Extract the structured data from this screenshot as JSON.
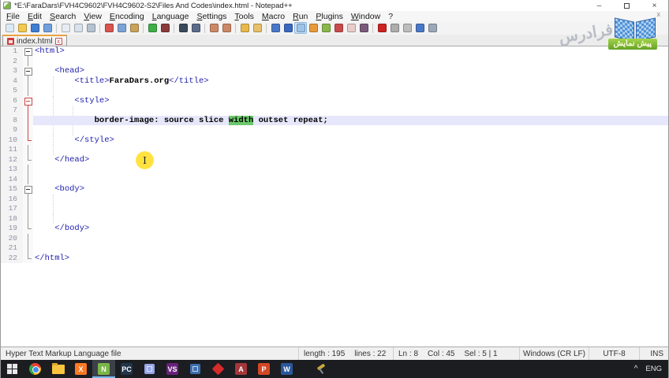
{
  "window": {
    "title": "*E:\\FaraDars\\FVH4C9602\\FVH4C9602-S2\\Files And Codes\\index.html - Notepad++",
    "controls": {
      "minimize": "–",
      "close": "×"
    }
  },
  "menubar": {
    "items": [
      "File",
      "Edit",
      "Search",
      "View",
      "Encoding",
      "Language",
      "Settings",
      "Tools",
      "Macro",
      "Run",
      "Plugins",
      "Window",
      "?"
    ]
  },
  "toolbar": {
    "icons": [
      {
        "name": "new-file-icon",
        "color": "#dce9f4"
      },
      {
        "name": "open-file-icon",
        "color": "#f2c94c"
      },
      {
        "name": "save-icon",
        "color": "#3f7fd2"
      },
      {
        "name": "save-all-icon",
        "color": "#6fa1dd"
      },
      {
        "name": "sep"
      },
      {
        "name": "close-icon",
        "color": "#e6ecf2"
      },
      {
        "name": "close-all-icon",
        "color": "#d9e2ec"
      },
      {
        "name": "print-icon",
        "color": "#b4c3d0"
      },
      {
        "name": "sep"
      },
      {
        "name": "cut-icon",
        "color": "#d9534f"
      },
      {
        "name": "copy-icon",
        "color": "#7aa3d8"
      },
      {
        "name": "paste-icon",
        "color": "#c9a35a"
      },
      {
        "name": "sep"
      },
      {
        "name": "undo-icon",
        "color": "#3fae49"
      },
      {
        "name": "redo-icon",
        "color": "#8b3a3a"
      },
      {
        "name": "sep"
      },
      {
        "name": "find-icon",
        "color": "#3a4a5a"
      },
      {
        "name": "replace-icon",
        "color": "#5a6a8a"
      },
      {
        "name": "sep"
      },
      {
        "name": "zoom-in-icon",
        "color": "#cc8866"
      },
      {
        "name": "zoom-out-icon",
        "color": "#cc8866"
      },
      {
        "name": "sep"
      },
      {
        "name": "sync-scroll-v-icon",
        "color": "#e8b84a"
      },
      {
        "name": "sync-scroll-h-icon",
        "color": "#e8c06a"
      },
      {
        "name": "sep"
      },
      {
        "name": "word-wrap-icon",
        "color": "#4a78c8"
      },
      {
        "name": "show-all-chars-icon",
        "color": "#3a68c0"
      },
      {
        "name": "indent-guide-icon",
        "color": "#9cc2e8",
        "active": true
      },
      {
        "name": "doc-map-icon",
        "color": "#e89a3a"
      },
      {
        "name": "function-list-icon",
        "color": "#8ab84a"
      },
      {
        "name": "edit-marker-icon",
        "color": "#c84a4a"
      },
      {
        "name": "disabled-icon",
        "color": "#e8cccc"
      },
      {
        "name": "monitoring-eye-icon",
        "color": "#7a5a7a"
      },
      {
        "name": "sep"
      },
      {
        "name": "record-macro-icon",
        "color": "#cc2222"
      },
      {
        "name": "stop-macro-icon",
        "color": "#adadad"
      },
      {
        "name": "play-macro-icon",
        "color": "#bdbdbd"
      },
      {
        "name": "run-macro-multi-icon",
        "color": "#4a78c8"
      },
      {
        "name": "save-macro-icon",
        "color": "#9aa8b8"
      }
    ]
  },
  "tabbar": {
    "tab_label": "index.html",
    "close_glyph": "x"
  },
  "editor": {
    "lines": [
      {
        "n": "1",
        "fold": "box",
        "segs": [
          [
            "<html>",
            "tag"
          ]
        ],
        "g": []
      },
      {
        "n": "2",
        "fold": "line",
        "segs": [],
        "g": []
      },
      {
        "n": "3",
        "fold": "box",
        "segs": [
          [
            "    ",
            "p"
          ],
          [
            "<head>",
            "tag"
          ]
        ],
        "g": []
      },
      {
        "n": "4",
        "fold": "line",
        "segs": [
          [
            "        ",
            "p"
          ],
          [
            "<title>",
            "tag"
          ],
          [
            "FaraDars.org",
            "b"
          ],
          [
            "</title>",
            "tag"
          ]
        ],
        "g": [
          4
        ]
      },
      {
        "n": "5",
        "fold": "line",
        "segs": [],
        "g": [
          4
        ]
      },
      {
        "n": "6",
        "fold": "box red",
        "segs": [
          [
            "        ",
            "p"
          ],
          [
            "<style>",
            "tag"
          ]
        ],
        "g": [
          4
        ]
      },
      {
        "n": "7",
        "fold": "line red",
        "segs": [],
        "g": [
          4,
          8
        ]
      },
      {
        "n": "8",
        "fold": "line red",
        "cur": true,
        "segs": [
          [
            "            ",
            "p"
          ],
          [
            "border-image: source slice ",
            "b"
          ],
          [
            "width",
            "sel"
          ],
          [
            " outset repeat;",
            "b"
          ]
        ],
        "g": []
      },
      {
        "n": "9",
        "fold": "line red",
        "segs": [],
        "g": [
          4,
          8
        ]
      },
      {
        "n": "10",
        "fold": "corner red",
        "segs": [
          [
            "        ",
            "p"
          ],
          [
            "</style>",
            "tag"
          ]
        ],
        "g": [
          4
        ]
      },
      {
        "n": "11",
        "fold": "line",
        "segs": [],
        "g": [
          4
        ]
      },
      {
        "n": "12",
        "fold": "corner",
        "segs": [
          [
            "    ",
            "p"
          ],
          [
            "</head>",
            "tag"
          ]
        ],
        "g": []
      },
      {
        "n": "13",
        "fold": "line",
        "segs": [],
        "g": []
      },
      {
        "n": "14",
        "fold": "line",
        "segs": [],
        "g": []
      },
      {
        "n": "15",
        "fold": "box",
        "segs": [
          [
            "    ",
            "p"
          ],
          [
            "<body>",
            "tag"
          ]
        ],
        "g": []
      },
      {
        "n": "16",
        "fold": "line",
        "segs": [],
        "g": [
          4
        ]
      },
      {
        "n": "17",
        "fold": "line",
        "segs": [],
        "g": [
          4
        ]
      },
      {
        "n": "18",
        "fold": "line",
        "segs": [],
        "g": [
          4
        ]
      },
      {
        "n": "19",
        "fold": "corner",
        "segs": [
          [
            "    ",
            "p"
          ],
          [
            "</body>",
            "tag"
          ]
        ],
        "g": []
      },
      {
        "n": "20",
        "fold": "line",
        "segs": [],
        "g": []
      },
      {
        "n": "21",
        "fold": "line",
        "segs": [],
        "g": []
      },
      {
        "n": "22",
        "fold": "corner",
        "segs": [
          [
            "</html>",
            "tag"
          ]
        ],
        "g": []
      }
    ]
  },
  "statusbar": {
    "doc_type": "Hyper Text Markup Language file",
    "length": "length : 195",
    "lines": "lines : 22",
    "ln": "Ln : 8",
    "col": "Col : 45",
    "sel": "Sel : 5 | 1",
    "eol": "Windows (CR LF)",
    "encoding": "UTF-8",
    "mode": "INS"
  },
  "taskbar": {
    "icons": [
      {
        "name": "start-button",
        "kind": "start"
      },
      {
        "name": "chrome-icon",
        "kind": "chrome"
      },
      {
        "name": "file-explorer-icon",
        "kind": "folder"
      },
      {
        "name": "xampp-icon",
        "kind": "letter",
        "color": "#fb7a24",
        "label": "X"
      },
      {
        "name": "notepad-plus-plus-icon",
        "kind": "letter",
        "color": "#7ab648",
        "label": "N",
        "active": true
      },
      {
        "name": "pycharm-icon",
        "kind": "letter",
        "color": "#21344a",
        "label": "PC"
      },
      {
        "name": "cube-light-app-icon",
        "kind": "cube",
        "color": "#97a7e8"
      },
      {
        "name": "visual-studio-icon",
        "kind": "letter",
        "color": "#68217a",
        "label": "VS"
      },
      {
        "name": "cube-dark-app-icon",
        "kind": "cube",
        "color": "#3d6fae"
      },
      {
        "name": "diamond-app-icon",
        "kind": "diamond",
        "color": "#d62b2b"
      },
      {
        "name": "access-icon",
        "kind": "letter",
        "color": "#a4373a",
        "label": "A"
      },
      {
        "name": "powerpoint-icon",
        "kind": "letter",
        "color": "#d24726",
        "label": "P"
      },
      {
        "name": "word-icon",
        "kind": "letter",
        "color": "#2b579a",
        "label": "W"
      },
      {
        "name": "tool-app-icon",
        "kind": "hammer",
        "gap": true
      }
    ],
    "tray": {
      "chevron": "^",
      "lang": "ENG"
    }
  },
  "watermark": {
    "brand": "فرادرس",
    "badge": "پیش نمایش",
    "close": "x"
  },
  "mouse": {
    "ibeam": "I"
  }
}
